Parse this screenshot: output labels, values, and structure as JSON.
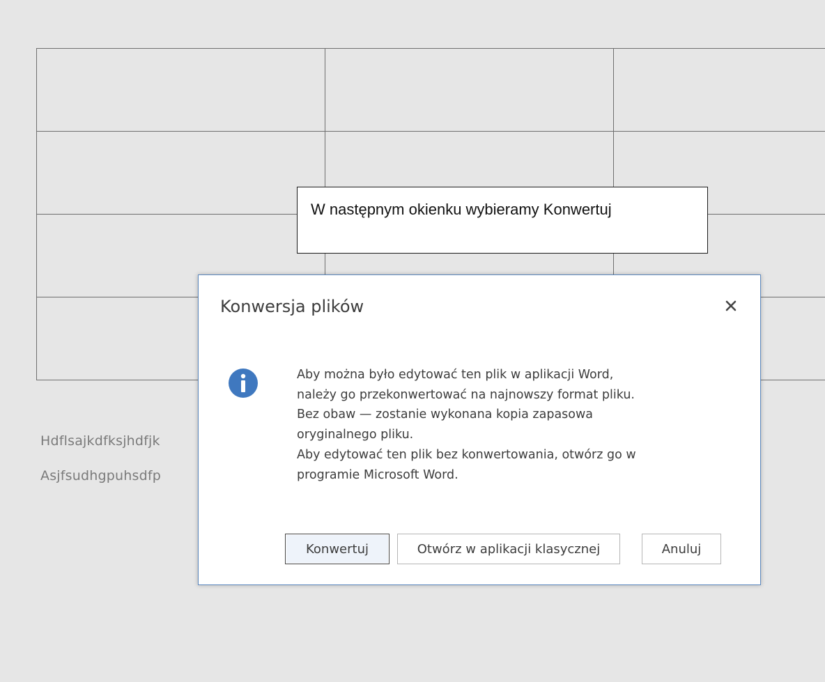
{
  "document": {
    "line1": "Hdflsajkdfksjhdfjk",
    "line2": "Asjfsudhgpuhsdfp"
  },
  "callout": {
    "text": "W następnym okienku wybieramy Konwertuj"
  },
  "dialog": {
    "title": "Konwersja plików",
    "close_icon": "close-icon",
    "info_icon": "info-icon",
    "info_icon_color": "#3f78bf",
    "message_lines": [
      "Aby można było edytować ten plik w aplikacji Word,",
      "należy go przekonwertować na najnowszy format pliku.",
      "Bez obaw — zostanie wykonana kopia zapasowa",
      "oryginalnego pliku.",
      "Aby edytować ten plik bez konwertowania, otwórz go w",
      "programie Microsoft Word."
    ],
    "buttons": {
      "convert": "Konwertuj",
      "open_desktop": "Otwórz w aplikacji klasycznej",
      "cancel": "Anuluj"
    }
  }
}
